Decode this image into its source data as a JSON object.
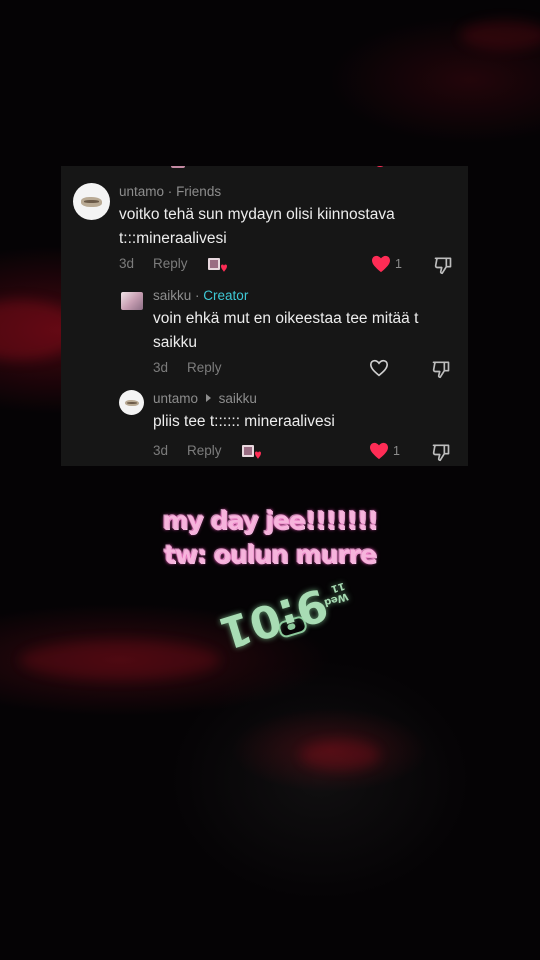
{
  "comments": [
    {
      "username": "untamo",
      "meta_sep": "·",
      "tag": "Friends",
      "text_line1": "voitko tehä sun mydayn olisi kiinnostava",
      "text_line2": "t:::mineraalivesi",
      "age": "3d",
      "reply_label": "Reply",
      "liked_by_creator": true,
      "liked": true,
      "likes": "1"
    },
    {
      "username": "saikku",
      "meta_sep": "·",
      "tag": "Creator",
      "text_line1": "voin ehkä mut en oikeestaa tee mitää t",
      "text_line2": "saikku",
      "age": "3d",
      "reply_label": "Reply",
      "liked_by_creator": false,
      "liked": false,
      "likes": ""
    },
    {
      "username": "untamo",
      "reply_to": "saikku",
      "text_line1": "pliis tee t:::::: mineraalivesi",
      "age": "3d",
      "reply_label": "Reply",
      "liked_by_creator": true,
      "liked": true,
      "likes": "1"
    }
  ],
  "caption": {
    "line1": "my day jee!!!!!!!",
    "line2": "tw: oulun murre"
  },
  "watch": {
    "time": "9:01",
    "date": "Wed 11"
  },
  "colors": {
    "heart": "#fe2c55",
    "creator_tag": "#3ec9d6",
    "caption_pink": "#f6b4dc",
    "watch_green": "#a8dcb4"
  },
  "icons": {
    "like": "heart-icon",
    "dislike": "thumbs-down-icon",
    "reply_arrow": "reply-arrow-icon"
  }
}
